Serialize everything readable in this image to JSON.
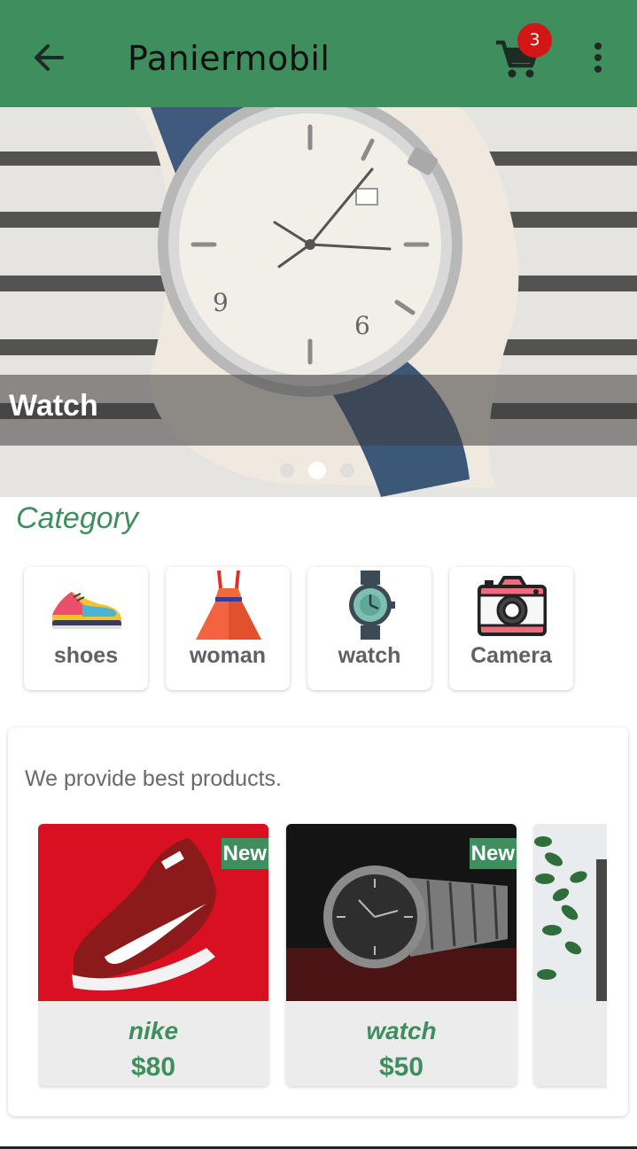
{
  "app_bar": {
    "title": "Paniermobil",
    "cart_count": "3",
    "back_icon": "arrow-left-icon",
    "cart_icon": "shopping-cart-icon",
    "menu_icon": "more-vert-icon",
    "color": "#3e8e5e"
  },
  "hero": {
    "caption": "Watch",
    "slide_count": 3,
    "active_slide": 2
  },
  "category": {
    "title": "Category",
    "items": [
      {
        "label": "shoes",
        "icon": "sneaker-icon"
      },
      {
        "label": "woman",
        "icon": "dress-icon"
      },
      {
        "label": "watch",
        "icon": "wristwatch-icon"
      },
      {
        "label": "Camera",
        "icon": "camera-icon"
      }
    ]
  },
  "products": {
    "headline": "We provide best products.",
    "items": [
      {
        "name": "nike",
        "price": "$80",
        "tag": "New"
      },
      {
        "name": "watch",
        "price": "$50",
        "tag": "New"
      },
      {
        "name": "",
        "price": "",
        "tag": ""
      }
    ]
  },
  "colors": {
    "accent": "#3e8e5e",
    "badge": "#d21616",
    "card_bg": "#ececec"
  }
}
